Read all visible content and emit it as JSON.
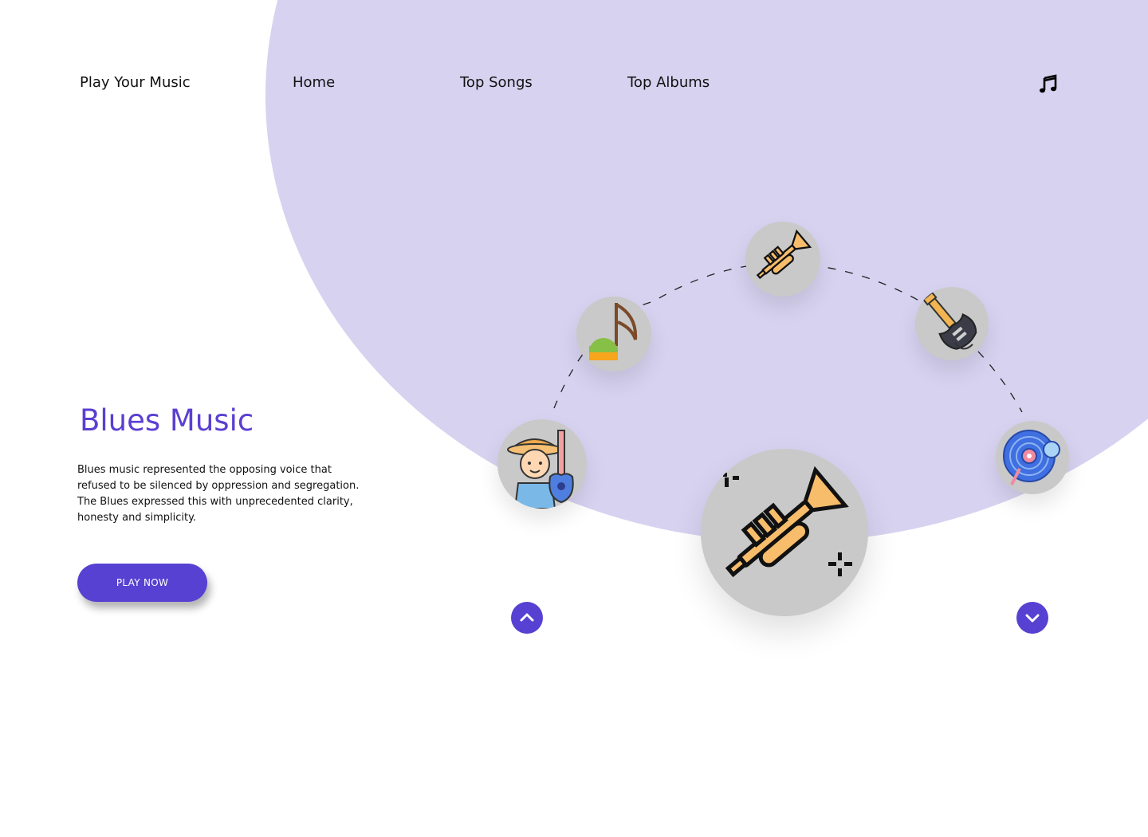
{
  "nav": {
    "brand": "Play Your Music",
    "links": [
      "Home",
      "Top Songs",
      "Top Albums"
    ],
    "icon": "music-note-icon"
  },
  "hero": {
    "title": "Blues Music",
    "description": "Blues music represented the opposing voice that refused to be silenced by oppression and segregation. The Blues expressed this with unprecedented clarity, honesty and simplicity.",
    "button_label": "PLAY NOW"
  },
  "carousel": {
    "items": [
      {
        "name": "guitar-player",
        "icon": "singer-with-guitar-icon"
      },
      {
        "name": "music-note",
        "icon": "eighth-note-icon"
      },
      {
        "name": "trumpet",
        "icon": "trumpet-icon"
      },
      {
        "name": "electric-guitar",
        "icon": "electric-guitar-icon"
      },
      {
        "name": "vinyl",
        "icon": "vinyl-record-icon"
      }
    ],
    "selected": {
      "name": "trumpet",
      "icon": "trumpet-icon"
    },
    "controls": {
      "prev": "chevron-up-icon",
      "next": "chevron-down-icon"
    }
  },
  "colors": {
    "accent": "#5641d2",
    "title": "#5a3fd1",
    "background_shape": "#d7d2f0",
    "orb": "#c9c9c9",
    "brass": "#f7bd6b"
  }
}
